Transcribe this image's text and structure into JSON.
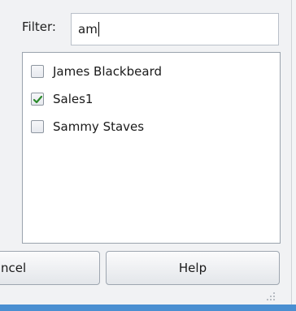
{
  "filter": {
    "label": "Filter:",
    "value": "am"
  },
  "list": {
    "items": [
      {
        "label": "James Blackbeard",
        "checked": false
      },
      {
        "label": "Sales1",
        "checked": true
      },
      {
        "label": "Sammy Staves",
        "checked": false
      }
    ]
  },
  "buttons": {
    "cancel_label": "ncel",
    "help_label": "Help"
  },
  "colors": {
    "checkmark": "#2b8a2b",
    "window_edge": "#4a8fd1"
  }
}
